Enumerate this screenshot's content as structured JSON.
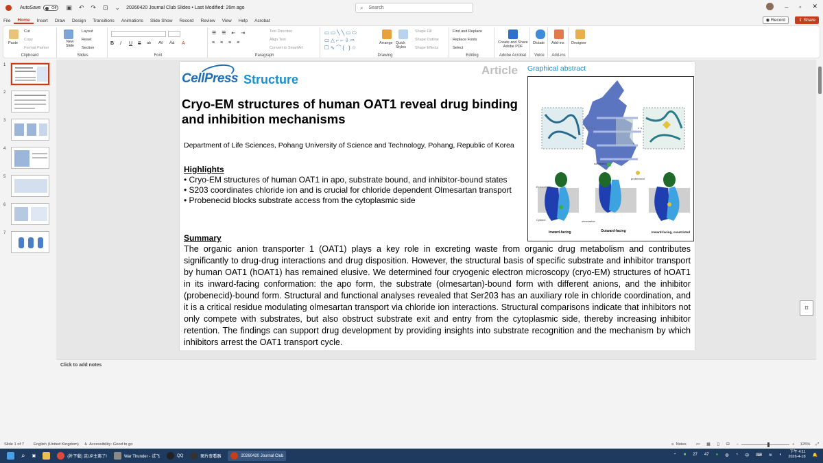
{
  "titlebar": {
    "autosave_label": "AutoSave",
    "autosave_state": "Off",
    "doc_title": "20260420 Journal Club Slides • Last Modified: 26m ago",
    "search_placeholder": "Search"
  },
  "menu": [
    "File",
    "Home",
    "Insert",
    "Draw",
    "Design",
    "Transitions",
    "Animations",
    "Slide Show",
    "Record",
    "Review",
    "View",
    "Help",
    "Acrobat"
  ],
  "menu_active": "Home",
  "record_label": "Record",
  "share_label": "Share",
  "ribbon": {
    "clipboard": {
      "paste": "Paste",
      "cut": "Cut",
      "copy": "Copy",
      "format_painter": "Format Painter",
      "label": "Clipboard"
    },
    "slides": {
      "new_slide": "New Slide",
      "layout": "Layout",
      "reset": "Reset",
      "section": "Section",
      "label": "Slides"
    },
    "font": {
      "label": "Font",
      "buttons": [
        "B",
        "I",
        "U",
        "S",
        "ab",
        "AV",
        "Aa"
      ]
    },
    "paragraph": {
      "text_direction": "Text Direction",
      "align_text": "Align Text",
      "convert_smartart": "Convert to SmartArt",
      "label": "Paragraph"
    },
    "drawing": {
      "arrange": "Arrange",
      "quick_styles": "Quick Styles",
      "shape_fill": "Shape Fill",
      "shape_outline": "Shape Outline",
      "shape_effects": "Shape Effects",
      "label": "Drawing"
    },
    "editing": {
      "find_replace": "Find and Replace",
      "replace_fonts": "Replace Fonts",
      "select": "Select",
      "label": "Editing"
    },
    "adobe": {
      "create_share": "Create and Share Adobe PDF",
      "label": "Adobe Acrobat"
    },
    "voice": {
      "dictate": "Dictate",
      "label": "Voice"
    },
    "addins": {
      "addins": "Add-ins",
      "label": "Add-ins"
    },
    "designer": {
      "designer": "Designer"
    }
  },
  "thumbnails": [
    "1",
    "2",
    "3",
    "4",
    "5",
    "6",
    "7"
  ],
  "slide": {
    "logo_cell": "CellPress",
    "logo_journal": "Structure",
    "article_label": "Article",
    "ga_title": "Graphical abstract",
    "ga_labels": {
      "substrates": "substrates",
      "probenecid": "probenecid",
      "olmesartan": "olmesartan",
      "inward": "Inward-facing",
      "outward": "Outward-facing",
      "constricted": "Inward-facing, constricted",
      "extracellular": "Extracellular",
      "cytosol": "Cytosol"
    },
    "title": "Cryo-EM structures of human OAT1 reveal drug binding and inhibition mechanisms",
    "affiliation": "Department of Life Sciences, Pohang University of Science and Technology, Pohang, Republic of Korea",
    "highlights_heading": "Highlights",
    "highlights": [
      "• Cryo-EM structures of human OAT1 in apo, substrate bound, and inhibitor-bound states",
      "• S203 coordinates chloride ion and is crucial for chloride dependent Olmesartan transport",
      "• Probenecid blocks substrate access from the cytoplasmic side"
    ],
    "summary_heading": "Summary",
    "summary": "The organic anion transporter 1 (OAT1) plays a key role in excreting waste from organic drug metabolism and contributes significantly to drug-drug interactions and drug disposition. However, the structural basis of specific substrate and inhibitor transport by human OAT1 (hOAT1) has remained elusive. We determined four cryogenic electron microscopy (cryo-EM) structures of hOAT1 in its inward-facing conformation: the apo form, the substrate (olmesartan)-bound form with different anions, and the inhibitor (probenecid)-bound form. Structural and functional analyses revealed that Ser203 has an auxiliary role in chloride coordination, and it is a critical residue modulating olmesartan transport via chloride ion interactions. Structural comparisons indicate that inhibitors not only compete with substrates, but also obstruct substrate exit and entry from the cytoplasmic side, thereby increasing inhibitor retention. The findings can support drug development by providing insights into substrate recognition and the mechanism by which inhibitors arrest the OAT1 transport cycle."
  },
  "notes_placeholder": "Click to add notes",
  "status": {
    "slide_of": "Slide 1 of 7",
    "language": "English (United Kingdom)",
    "accessibility": "Accessibility: Good to go",
    "notes": "Notes",
    "zoom": "125%"
  },
  "taskbar": {
    "items": [
      "(补下载) 这UP主离了!",
      "War Thunder - 试飞",
      "QQ",
      "图片查看器",
      "20260420 Journal Club"
    ],
    "tray_temp": "27",
    "tray_num": "47",
    "ime": "中",
    "time": "下午 4:11",
    "date": "2026-4-18"
  }
}
